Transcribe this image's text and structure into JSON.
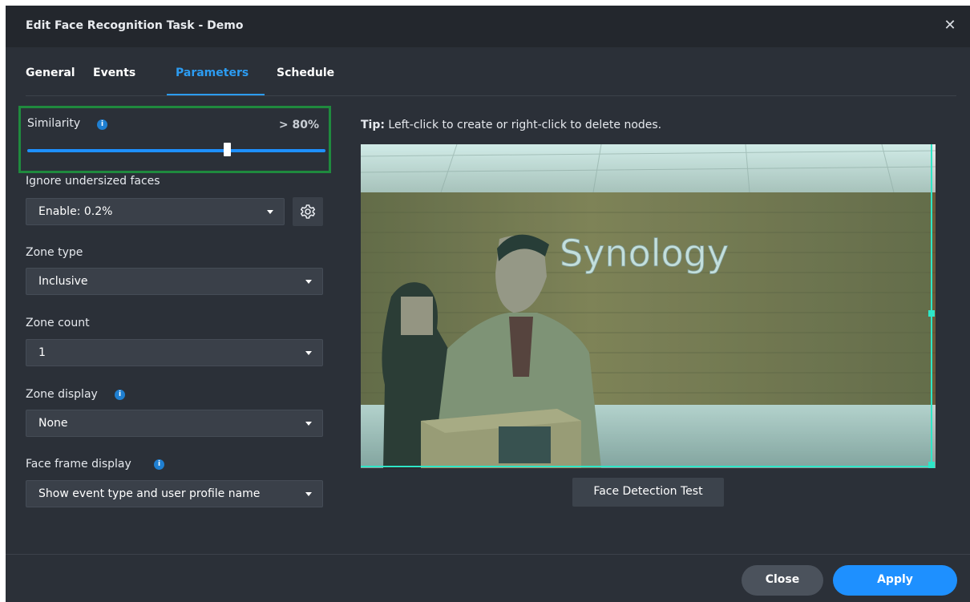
{
  "window": {
    "title": "Edit Face Recognition Task - Demo",
    "close_label": "✕"
  },
  "tabs": [
    {
      "label": "General",
      "active": false
    },
    {
      "label": "Events",
      "active": false
    },
    {
      "label": "Parameters",
      "active": true
    },
    {
      "label": "Schedule",
      "active": false
    }
  ],
  "similarity": {
    "label": "Similarity",
    "value_text": "> 80%",
    "slider_value": 0.67
  },
  "undersized": {
    "label": "Ignore undersized faces",
    "value": "Enable: 0.2%"
  },
  "zone_type": {
    "label": "Zone type",
    "value": "Inclusive"
  },
  "zone_count": {
    "label": "Zone count",
    "value": "1"
  },
  "zone_display": {
    "label": "Zone display",
    "value": "None"
  },
  "face_frame": {
    "label": "Face frame display",
    "value": "Show event type and user profile name"
  },
  "tip": {
    "prefix": "Tip:",
    "text": "Left-click to create or right-click to delete nodes."
  },
  "preview": {
    "wall_text": "Synology"
  },
  "buttons": {
    "face_test": "Face Detection Test",
    "close": "Close",
    "apply": "Apply"
  },
  "colors": {
    "accent": "#1e90ff",
    "highlight_border": "#1f8a3e",
    "zone": "#2ee6c8",
    "background": "#2b3038"
  },
  "icons": [
    "close-icon",
    "info-icon",
    "gear-icon",
    "chevron-down-icon"
  ]
}
